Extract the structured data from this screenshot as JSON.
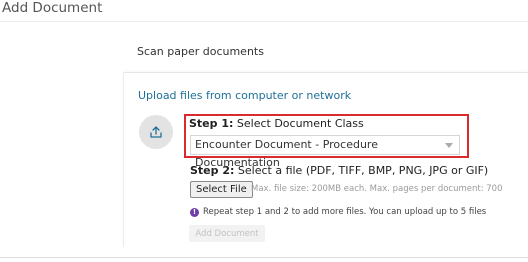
{
  "page": {
    "title": "Add Document"
  },
  "scan": {
    "label": "Scan paper documents"
  },
  "upload": {
    "title": "Upload files from computer or network",
    "icon": "upload-icon",
    "step1": {
      "prefix": "Step 1:",
      "text": " Select Document Class",
      "selected_value": "Encounter Document - Procedure Documentation"
    },
    "step2": {
      "prefix": "Step 2:",
      "text": " Select a file (PDF, TIFF, BMP, PNG, JPG or GIF)",
      "button_label": "Select File",
      "hint": "Max. file size: 200MB each. Max. pages per document: 700"
    },
    "note": "Repeat step 1 and 2 to add more files. You can upload up to 5 files",
    "note_icon_glyph": "!",
    "add_button_label": "Add Document"
  },
  "colors": {
    "highlight_border": "#d92b2b",
    "link_blue": "#1f6f98",
    "info_purple": "#6e3ea6"
  }
}
